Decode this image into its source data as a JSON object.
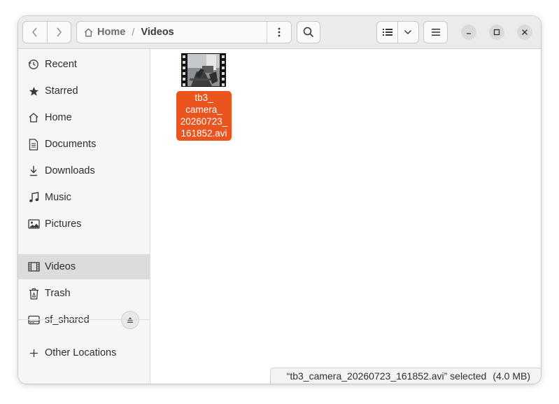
{
  "header": {
    "back_icon": "chevron-left-icon",
    "forward_icon": "chevron-right-icon",
    "path": {
      "home_label": "Home",
      "separator": "/",
      "current": "Videos"
    },
    "path_menu_icon": "vertical-ellipsis-icon",
    "search_icon": "search-icon",
    "view_list_icon": "list-view-icon",
    "view_options_icon": "chevron-down-icon",
    "main_menu_icon": "hamburger-menu-icon",
    "window_controls": [
      "minimize",
      "maximize",
      "close"
    ]
  },
  "sidebar": {
    "items": [
      {
        "label": "Recent",
        "icon": "clock-icon"
      },
      {
        "label": "Starred",
        "icon": "star-icon"
      },
      {
        "label": "Home",
        "icon": "home-icon"
      },
      {
        "label": "Documents",
        "icon": "document-icon"
      },
      {
        "label": "Downloads",
        "icon": "download-icon"
      },
      {
        "label": "Music",
        "icon": "music-icon"
      },
      {
        "label": "Pictures",
        "icon": "picture-icon"
      },
      {
        "label": "Videos",
        "icon": "film-icon",
        "active": true
      },
      {
        "label": "Trash",
        "icon": "trash-icon"
      },
      {
        "label": "sf_shared",
        "icon": "drive-icon",
        "eject": true
      }
    ],
    "other_locations": "Other Locations"
  },
  "files": [
    {
      "name": "tb3_\ncamera_\n20260723_\n161852.avi",
      "selected": true,
      "type": "video"
    }
  ],
  "status": {
    "text": "“tb3_camera_20260723_161852.avi” selected",
    "size": "(4.0 MB)"
  },
  "colors": {
    "accent": "#e9541f",
    "sidebar_bg": "#f6f6f6",
    "header_bg": "#ebebeb",
    "active_item": "#dcdcdc"
  }
}
